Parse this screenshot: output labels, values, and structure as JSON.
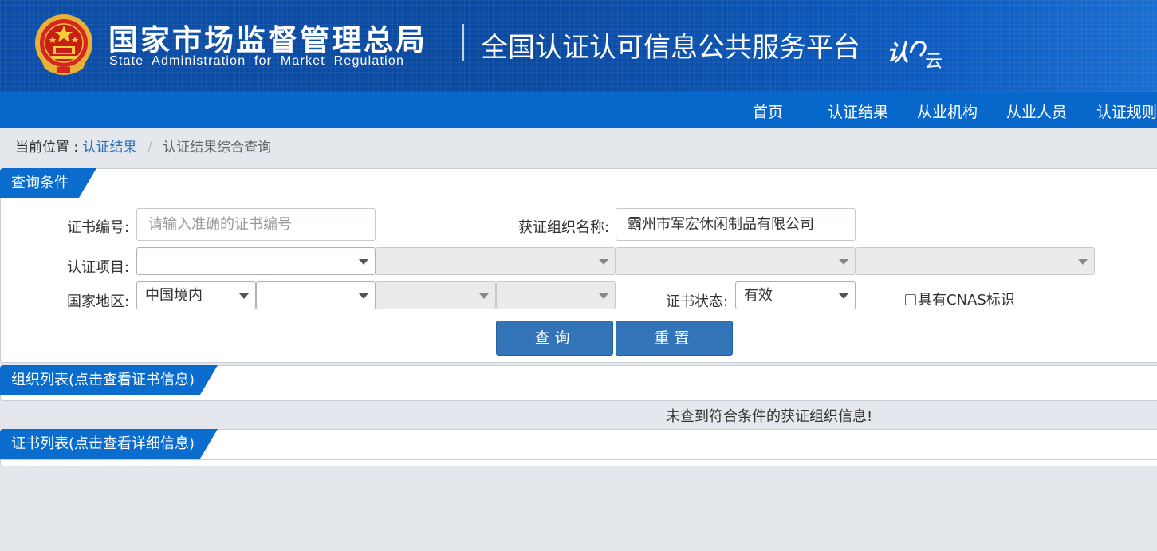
{
  "header": {
    "agency_cn": "国家市场监督管理总局",
    "agency_en": "State Administration  for  Market Regulation",
    "platform_title": "全国认证认可信息公共服务平台",
    "logo_text": "认云",
    "emblem_icon": "national-emblem-icon"
  },
  "nav": {
    "items": [
      {
        "label": "首页"
      },
      {
        "label": "认证结果"
      },
      {
        "label": "从业机构"
      },
      {
        "label": "从业人员"
      },
      {
        "label": "认证规则"
      }
    ]
  },
  "breadcrumb": {
    "prefix": "当前位置 :",
    "link": "认证结果",
    "separator": "/",
    "current": "认证结果综合查询"
  },
  "query_panel": {
    "title": "查询条件",
    "cert_no_label": "证书编号:",
    "cert_no_placeholder": "请输入准确的证书编号",
    "org_name_label": "获证组织名称:",
    "org_name_value": "霸州市军宏休闲制品有限公司",
    "project_label": "认证项目:",
    "project_selects": [
      "",
      "",
      "",
      ""
    ],
    "region_label": "国家地区:",
    "region_selects": [
      "中国境内",
      "",
      "",
      ""
    ],
    "status_label": "证书状态:",
    "status_value": "有效",
    "cnas_label": "具有CNAS标识",
    "query_button": "查询",
    "reset_button": "重置"
  },
  "org_list": {
    "title": "组织列表(点击查看证书信息)",
    "empty_message": "未查到符合条件的获证组织信息!"
  },
  "cert_list": {
    "title": "证书列表(点击查看详细信息)"
  },
  "colors": {
    "banner": "#0d4fa8",
    "nav": "#0867cb",
    "tab": "#0a6ccc",
    "button": "#3373b7",
    "link": "#2f6fb7"
  }
}
